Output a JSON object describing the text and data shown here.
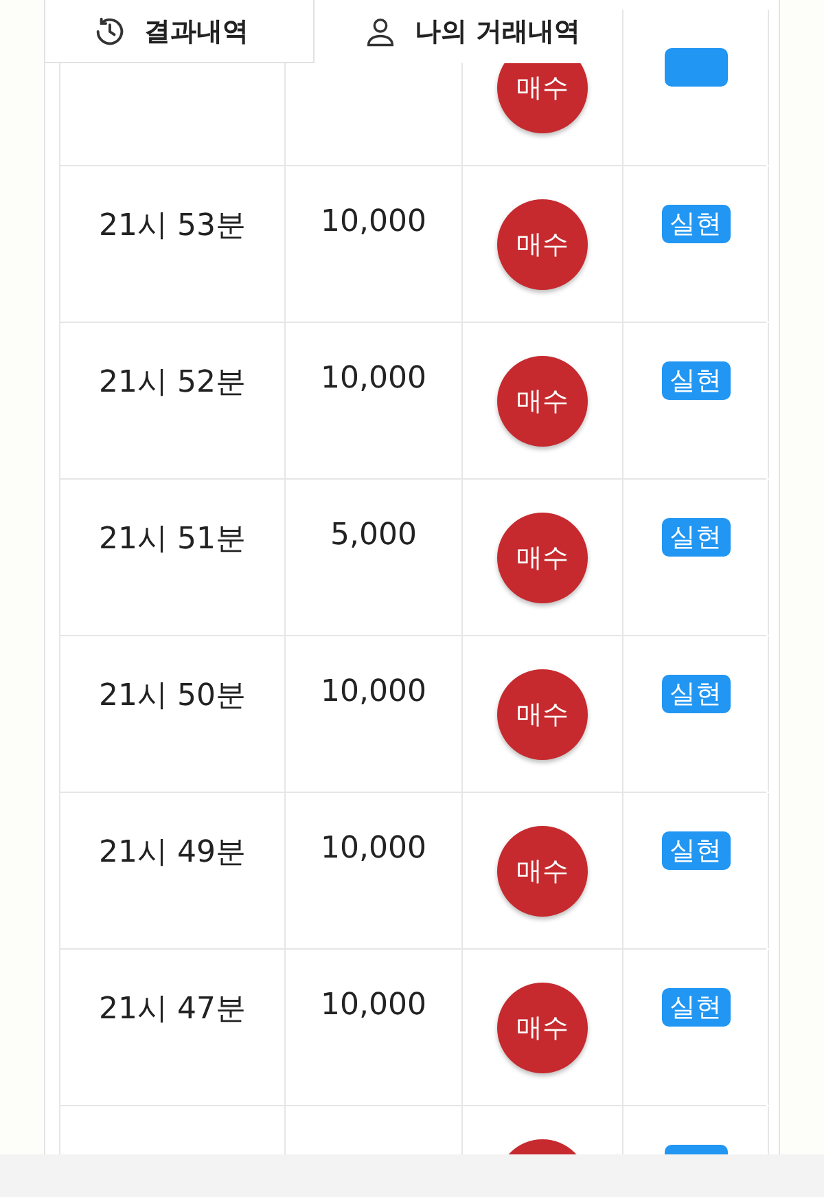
{
  "tabs": [
    {
      "label": "결과내역",
      "selected": true
    },
    {
      "label": "나의 거래내역",
      "selected": false
    }
  ],
  "rows": [
    {
      "action": "매수"
    },
    {
      "time": "21시 53분",
      "amount": "10,000",
      "action": "매수",
      "result": "실현"
    },
    {
      "time": "21시 52분",
      "amount": "10,000",
      "action": "매수",
      "result": "실현"
    },
    {
      "time": "21시 51분",
      "amount": "5,000",
      "action": "매수",
      "result": "실현"
    },
    {
      "time": "21시 50분",
      "amount": "10,000",
      "action": "매수",
      "result": "실현"
    },
    {
      "time": "21시 49분",
      "amount": "10,000",
      "action": "매수",
      "result": "실현"
    },
    {
      "time": "21시 47분",
      "amount": "10,000",
      "action": "매수",
      "result": "실현"
    },
    {}
  ]
}
